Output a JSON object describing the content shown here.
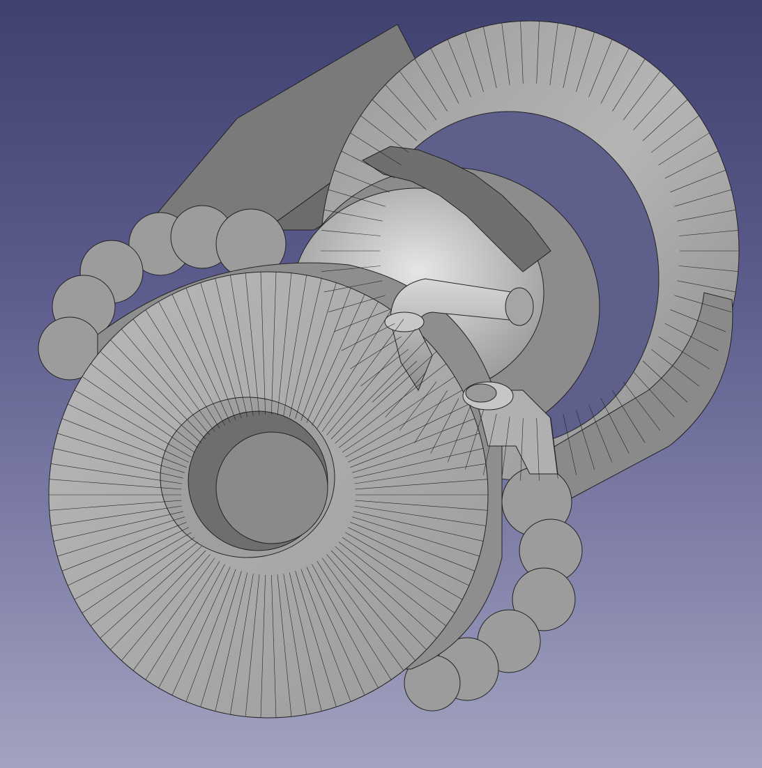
{
  "viewport": {
    "background": {
      "top": "#3f416f",
      "middle": "#5a5a8b",
      "lower": "#7f7fa8",
      "bottom": "#a3a3c0"
    },
    "mesh_color": "#202020",
    "face_light": "#cfcfcf",
    "face_mid": "#a8a8a8",
    "face_dark": "#5a5a5a"
  },
  "model": {
    "parts": [
      "outer-ring",
      "bearing-housing",
      "roller-bearing-balls",
      "inner-pipe-elbow",
      "mounting-bracket",
      "front-flange-with-bore"
    ]
  }
}
